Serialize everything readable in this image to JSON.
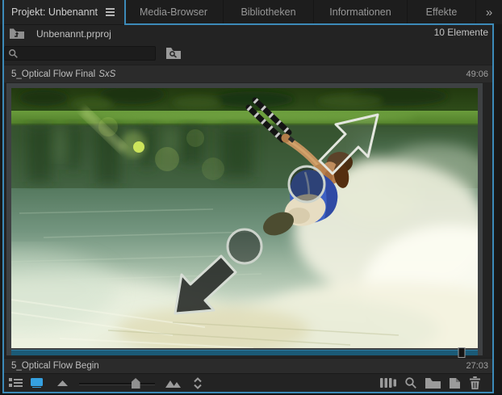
{
  "tabs": {
    "active": {
      "label": "Projekt: Unbenannt"
    },
    "inactive": [
      "Media-Browser",
      "Bibliotheken",
      "Informationen",
      "Effekte"
    ],
    "overflow_glyph": "»"
  },
  "header": {
    "bin_path": "Unbenannt.prproj",
    "item_count": "10 Elemente"
  },
  "search": {
    "value": "",
    "placeholder": ""
  },
  "items": [
    {
      "name": "5_Optical Flow Final",
      "name_suffix": "SxS",
      "duration": "49:06"
    },
    {
      "name": "5_Optical Flow Begin",
      "duration": "27:03",
      "scrub_position": 0.965
    }
  ],
  "toolbar": {
    "active_view": "icon",
    "zoom_slider_position": 0.74,
    "active_view_color": "#35a0e0"
  },
  "colors": {
    "panel_focus_border": "#3c8ab8",
    "scrub_bar": "#1b5a77",
    "selection_frame": "#3e4143"
  }
}
